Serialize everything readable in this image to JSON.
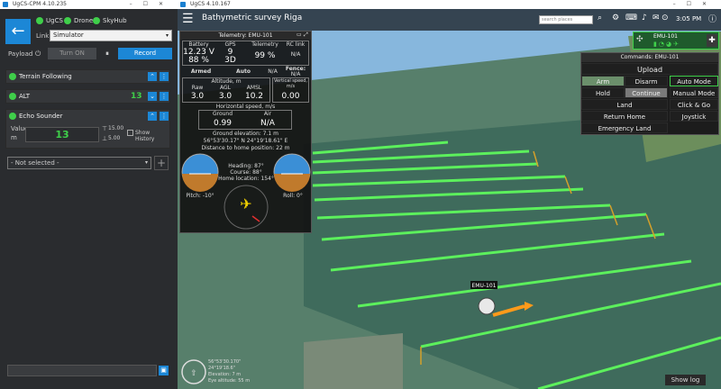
{
  "left_window": {
    "title": "UgCS-CPM 4.10.235",
    "connections": [
      {
        "label": "UgCS"
      },
      {
        "label": "Drone"
      },
      {
        "label": "SkyHub"
      }
    ],
    "link_label": "Link",
    "link_value": "Simulator",
    "payload_label": "Payload",
    "turn_on_label": "Turn ON",
    "record_label": "Record",
    "terrain_following_label": "Terrain Following",
    "alt_label": "ALT",
    "alt_value": "13",
    "echo_sounder_label": "Echo Sounder",
    "value_label": "Value",
    "value_unit": "m",
    "echo_value": "13",
    "range_max": "15.00",
    "range_min": "5.00",
    "show_history_label": "Show History",
    "not_selected_label": "- Not selected -",
    "add_label": "+"
  },
  "main_window": {
    "title": "UgCS 4.10.167",
    "mission_title": "Bathymetric survey Riga",
    "search_placeholder": "search places",
    "time": "3:05 PM",
    "vehicle_name": "EMU-101",
    "show_log_label": "Show log",
    "vehicle_label_on_map": "EMU-101",
    "compass_text": [
      "56°53'30.170\"",
      "24°19'18.6\"",
      "Elevation: 7 m",
      "Eye altitude: 55 m"
    ]
  },
  "telemetry": {
    "header": "Telemetry: EMU-101",
    "col_headers": [
      "Battery",
      "GPS",
      "Telemetry",
      "RC link"
    ],
    "battery_voltage": "12.23 V",
    "battery_percent": "88 %",
    "gps_sats": "9",
    "gps_fix": "3D",
    "telemetry_value": "99 %",
    "rc_value": "N/A",
    "armed_label": "Armed",
    "mode_label": "Auto",
    "na_label": "N/A",
    "fence_label": "Fence:",
    "fence_value": "N/A",
    "altitude_header": "Altitude, m",
    "vs_header": "Vertical speed, m/s",
    "raw_label": "Raw",
    "agl_label": "AGL",
    "amsl_label": "AMSL",
    "raw_value": "3.0",
    "agl_value": "3.0",
    "amsl_value": "10.2",
    "vs_value": "0.00",
    "hspeed_header": "Horizontal speed, m/s",
    "ground_label": "Ground",
    "air_label": "Air",
    "ground_value": "0.99",
    "air_value": "N/A",
    "ground_elevation": "Ground elevation: 7.1 m",
    "coords": "56°53'30.17\" N  24°19'18.61\" E",
    "distance_home": "Distance to home position: 22 m",
    "heading": "Heading: 87°",
    "course": "Course: 88°",
    "home_location": "Home location: 154°",
    "pitch": "Pitch: -10°",
    "roll": "Roll: 0°"
  },
  "commands": {
    "header": "Commands: EMU-101",
    "upload": "Upload",
    "arm": "Arm",
    "disarm": "Disarm",
    "auto_mode": "Auto Mode",
    "hold": "Hold",
    "continue": "Continue",
    "manual_mode": "Manual Mode",
    "land": "Land",
    "click_go": "Click & Go",
    "return_home": "Return Home",
    "joystick": "Joystick",
    "emergency_land": "Emergency Land"
  },
  "colors": {
    "accent_blue": "#1c87d6",
    "status_green": "#3fcf4a",
    "grid_green": "#5cf05c",
    "water": "#3f6b5c"
  }
}
